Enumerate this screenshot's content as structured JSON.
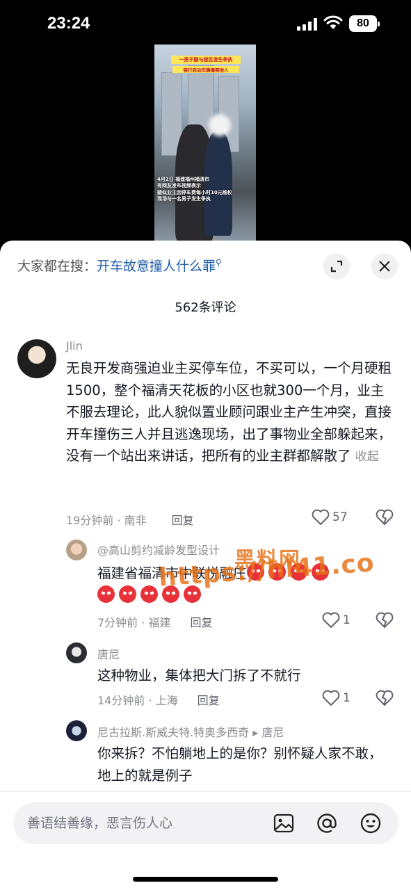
{
  "status_bar": {
    "time": "23:24",
    "battery": "80"
  },
  "video": {
    "title": "一男子疑与居民发生争执",
    "subtitle": "强行启动车辆撞倒他人",
    "caption_lines": [
      "4月2日 福建福州福清市",
      "有网友发布视频表示",
      "疑似业主因停车费每小时10元维权",
      "现场与一名男子发生争执"
    ]
  },
  "header": {
    "search_prefix": "大家都在搜：",
    "search_keyword": "开车故意撞人什么罪",
    "comment_count": "562条评论"
  },
  "comments": [
    {
      "user": "Jlin",
      "text": "无良开发商强迫业主买停车位，不买可以，一个月硬租1500，整个福清天花板的小区也就300一个月，业主不服去理论，此人貌似置业顾问跟业主产生冲突，直接开车撞伤三人并且逃逸现场，出了事物业全部躲起来，没有一个站出来讲话，把所有的业主群都解散了",
      "collapse": "收起",
      "time_location": "19分钟前 · 南非",
      "reply": "回复",
      "likes": "57"
    },
    {
      "user": "@高山剪约减龄发型设计",
      "text": "福建省福清市中联悦融庄",
      "time_location": "7分钟前 · 福建",
      "reply": "回复",
      "likes": "1"
    },
    {
      "user": "唐尼",
      "text": "这种物业，集体把大门拆了不就行",
      "time_location": "14分钟前 · 上海",
      "reply": "回复",
      "likes": "1"
    },
    {
      "user": "尼古拉斯.斯威夫特.特奥多西奇",
      "reply_to_arrow": "▸",
      "reply_to": "唐尼",
      "text": "你来拆？不怕躺地上的是你？别怀疑人家不敢，地上的就是例子"
    }
  ],
  "watermark": {
    "top": "黑料网",
    "url": "https://hl41.co"
  },
  "input": {
    "placeholder": "善语结善缘，恶言伤人心"
  },
  "colors": {
    "keyword": "#1f5ea8",
    "watermark": "#e77015",
    "emoji": "#e8323a"
  }
}
